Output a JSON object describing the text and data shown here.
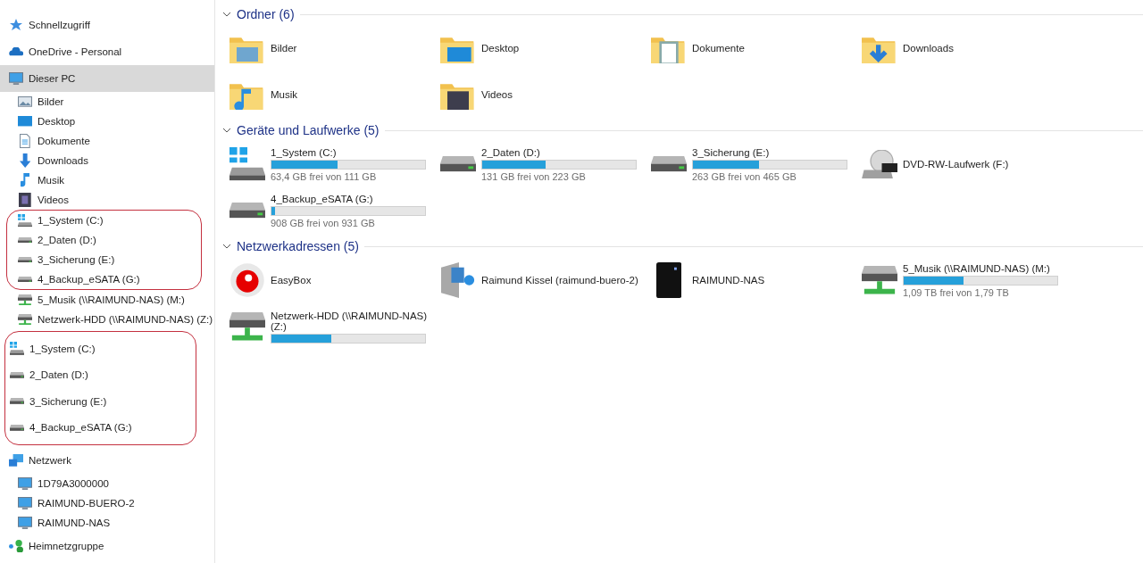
{
  "sidebar": {
    "items": [
      {
        "kind": "star",
        "label": "Schnellzugriff",
        "selected": false
      },
      {
        "kind": "cloud",
        "label": "OneDrive - Personal",
        "selected": false
      },
      {
        "kind": "computer",
        "label": "Dieser PC",
        "selected": true,
        "children": [
          {
            "kind": "pictures",
            "label": "Bilder",
            "selected": false
          },
          {
            "kind": "desktop",
            "label": "Desktop",
            "selected": false
          },
          {
            "kind": "documents",
            "label": "Dokumente",
            "selected": false
          },
          {
            "kind": "downloads",
            "label": "Downloads",
            "selected": false
          },
          {
            "kind": "music",
            "label": "Musik",
            "selected": false
          },
          {
            "kind": "videos",
            "label": "Videos",
            "selected": false
          },
          {
            "kind": "circled",
            "items": [
              {
                "kind": "windrive",
                "label": "1_System (C:)",
                "selected": false
              },
              {
                "kind": "drive",
                "label": "2_Daten (D:)",
                "selected": false
              },
              {
                "kind": "drive",
                "label": "3_Sicherung (E:)",
                "selected": false
              },
              {
                "kind": "drive",
                "label": "4_Backup_eSATA (G:)",
                "selected": false
              }
            ]
          },
          {
            "kind": "netdrive",
            "label": "5_Musik (\\\\RAIMUND-NAS) (M:)",
            "selected": false
          },
          {
            "kind": "netdrive",
            "label": "Netzwerk-HDD (\\\\RAIMUND-NAS) (Z:)",
            "selected": false
          }
        ]
      },
      {
        "kind": "circled",
        "items": [
          {
            "kind": "windrive",
            "label": "1_System (C:)",
            "selected": false
          },
          {
            "kind": "drive",
            "label": "2_Daten (D:)",
            "selected": false
          },
          {
            "kind": "drive",
            "label": "3_Sicherung (E:)",
            "selected": false
          },
          {
            "kind": "drive",
            "label": "4_Backup_eSATA (G:)",
            "selected": false
          }
        ]
      },
      {
        "kind": "network",
        "label": "Netzwerk",
        "selected": false,
        "children": [
          {
            "kind": "computer",
            "label": "1D79A3000000",
            "selected": false
          },
          {
            "kind": "computer",
            "label": "RAIMUND-BUERO-2",
            "selected": false
          },
          {
            "kind": "computer",
            "label": "RAIMUND-NAS",
            "selected": false
          }
        ]
      },
      {
        "kind": "homegroup",
        "label": "Heimnetzgruppe",
        "selected": false
      }
    ]
  },
  "sections": [
    {
      "title": "Ordner (6)",
      "expanded": true,
      "items": [
        {
          "kind": "pictures",
          "name": "Bilder"
        },
        {
          "kind": "desktop",
          "name": "Desktop"
        },
        {
          "kind": "documents",
          "name": "Dokumente"
        },
        {
          "kind": "downloads",
          "name": "Downloads"
        },
        {
          "kind": "music",
          "name": "Musik"
        },
        {
          "kind": "videos",
          "name": "Videos"
        }
      ]
    },
    {
      "title": "Geräte und Laufwerke (5)",
      "expanded": true,
      "items": [
        {
          "kind": "windrive",
          "name": "1_System (C:)",
          "level": 0.43,
          "free": "63,4 GB frei von 111 GB"
        },
        {
          "kind": "drive",
          "name": "2_Daten (D:)",
          "level": 0.41,
          "free": "131 GB frei von 223 GB"
        },
        {
          "kind": "drive",
          "name": "3_Sicherung (E:)",
          "level": 0.43,
          "free": "263 GB frei von 465 GB"
        },
        {
          "kind": "dvd",
          "name": "DVD-RW-Laufwerk (F:)"
        },
        {
          "kind": "drive",
          "name": "4_Backup_eSATA (G:)",
          "level": 0.025,
          "free": "908 GB frei von 931 GB"
        }
      ]
    },
    {
      "title": "Netzwerkadressen (5)",
      "expanded": true,
      "items": [
        {
          "kind": "router",
          "name": "EasyBox"
        },
        {
          "kind": "mediaserver",
          "name": "Raimund Kissel (raimund-buero-2)"
        },
        {
          "kind": "nas",
          "name": "RAIMUND-NAS"
        },
        {
          "kind": "netdrive",
          "name": "5_Musik (\\\\RAIMUND-NAS) (M:)",
          "level": 0.39,
          "free": "1,09 TB frei von 1,79 TB"
        },
        {
          "kind": "netdrive",
          "name": "Netzwerk-HDD (\\\\RAIMUND-NAS) (Z:)",
          "level": 0.39
        }
      ]
    }
  ]
}
